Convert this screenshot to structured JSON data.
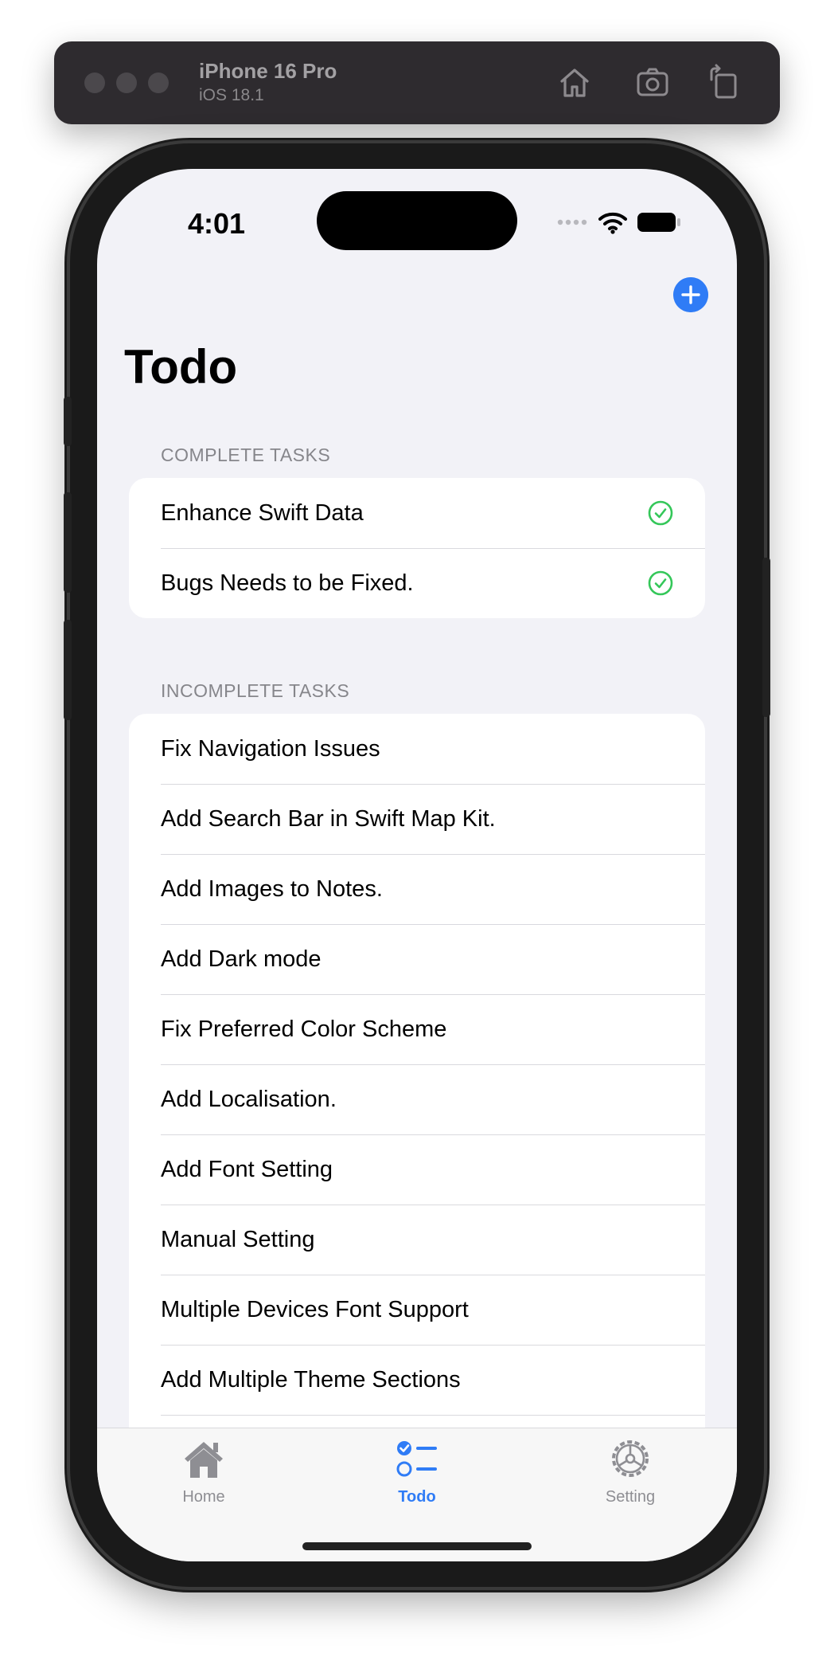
{
  "simulator": {
    "device_name": "iPhone 16 Pro",
    "os_version": "iOS 18.1",
    "icons": [
      "home-icon",
      "screenshot-icon",
      "rotate-icon"
    ]
  },
  "status_bar": {
    "time": "4:01"
  },
  "nav": {
    "title": "Todo",
    "add_icon": "plus-circle-icon",
    "accent": "#2f7cf6"
  },
  "sections": {
    "complete": {
      "header": "COMPLETE TASKS",
      "items": [
        "Enhance Swift Data",
        "Bugs Needs to be Fixed."
      ],
      "check_color": "#34c759"
    },
    "incomplete": {
      "header": "INCOMPLETE TASKS",
      "items": [
        "Fix Navigation Issues",
        "Add Search Bar in Swift Map Kit.",
        "Add Images to Notes.",
        "Add Dark mode",
        "Fix Preferred Color Scheme",
        "Add Localisation.",
        "Add Font Setting",
        "Manual Setting",
        "Multiple Devices Font Support",
        "Add Multiple Theme Sections"
      ]
    }
  },
  "tabbar": {
    "tabs": [
      {
        "label": "Home",
        "icon": "house-icon",
        "selected": false
      },
      {
        "label": "Todo",
        "icon": "checklist-icon",
        "selected": true
      },
      {
        "label": "Setting",
        "icon": "gear-icon",
        "selected": false
      }
    ],
    "active_color": "#2f7cf6",
    "inactive_color": "#8e8e93"
  }
}
